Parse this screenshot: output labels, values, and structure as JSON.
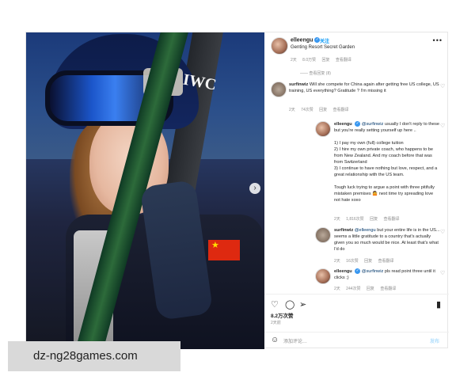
{
  "post": {
    "username": "elleengu",
    "follow_label": "关注",
    "location": "Genting Resort Secret Garden",
    "more_label": "•••",
    "caption_meta": {
      "time": "2天",
      "likes": "8.0万赞",
      "reply": "回复",
      "translate": "查看翻译"
    },
    "view_replies": "—— 查看回复 (8)",
    "likes": "8.2万次赞",
    "date": "2天前",
    "comment_placeholder": "添加评论…",
    "post_label": "发布"
  },
  "comments": [
    {
      "username": "surfinwiz",
      "text": "Will she compete for China again after getting free US college, US training, US everything? Gratitude ? I'm missing it",
      "meta": {
        "time": "2天",
        "likes": "74次赞",
        "reply": "回复",
        "translate": "查看翻译"
      }
    },
    {
      "username": "elleengu",
      "mention": "@surfinwiz",
      "lines": [
        "usually I don't reply to these",
        "but you're really setting yourself up here ..",
        "",
        "1) I pay my own (full) college tuition",
        "2) I hire my own private coach, who happens to be",
        "from New Zealand. And my coach before that was",
        "from Switzerland",
        "3) I continue to have nothing but love, respect, and a",
        "great relationship with the US team.",
        "",
        "Tough luck trying to argue a point with three pitifully",
        "mistaken premises 🤷 next time try spreading love",
        "not hate xoxo"
      ],
      "meta": {
        "time": "2天",
        "likes": "1,816次赞",
        "reply": "回复",
        "translate": "查看翻译"
      }
    },
    {
      "username": "surfinwiz",
      "mention": "@elleengu",
      "lines": [
        "but your entire life is in the US...",
        "seems a little gratitude to a country that's actually",
        "given you so much would be nice. At least that's what",
        "I'd do"
      ],
      "meta": {
        "time": "2天",
        "likes": "16次赞",
        "reply": "回复",
        "translate": "查看翻译"
      }
    },
    {
      "username": "elleengu",
      "mention": "@surfinwiz",
      "lines": [
        "pls read point three until it",
        "clicks ;)"
      ],
      "meta": {
        "time": "2天",
        "likes": "244次赞",
        "reply": "回复",
        "translate": "查看翻译"
      }
    }
  ],
  "photo": {
    "brand_text": "IWC",
    "flag_star": "★",
    "next_arrow": "›"
  },
  "icons": {
    "like": "heart-icon",
    "comment": "comment-icon",
    "share": "share-icon",
    "save": "bookmark-icon",
    "emoji": "smiley-icon"
  },
  "watermark": "dz-ng28games.com"
}
